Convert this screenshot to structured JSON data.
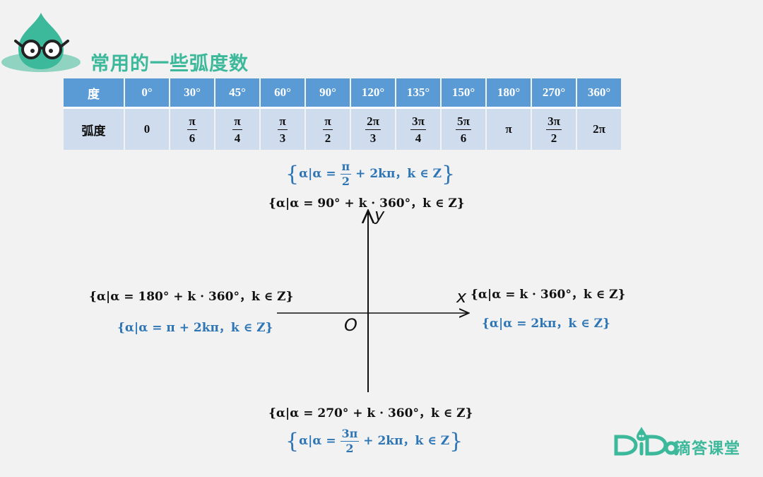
{
  "title": "常用的一些弧度数",
  "table": {
    "row1_label": "度",
    "row2_label": "弧度",
    "degrees": [
      "0°",
      "30°",
      "45°",
      "60°",
      "90°",
      "120°",
      "135°",
      "150°",
      "180°",
      "270°",
      "360°"
    ],
    "radians": [
      {
        "text": "0"
      },
      {
        "num": "π",
        "den": "6"
      },
      {
        "num": "π",
        "den": "4"
      },
      {
        "num": "π",
        "den": "3"
      },
      {
        "num": "π",
        "den": "2"
      },
      {
        "num": "2π",
        "den": "3"
      },
      {
        "num": "3π",
        "den": "4"
      },
      {
        "num": "5π",
        "den": "6"
      },
      {
        "text": "π"
      },
      {
        "num": "3π",
        "den": "2"
      },
      {
        "text": "2π"
      }
    ]
  },
  "axes": {
    "x_label": "x",
    "y_label": "y",
    "origin_label": "O"
  },
  "formulas": {
    "top_rad_pre": "α|α =",
    "top_rad_num": "π",
    "top_rad_den": "2",
    "top_rad_post": "+ 2kπ，k ∈ Z",
    "top_deg": "{α|α = 90° + k · 360°，k ∈ Z}",
    "left_deg": "{α|α = 180° + k · 360°，k ∈ Z}",
    "left_rad": "{α|α = π + 2kπ，k ∈ Z}",
    "right_deg": "{α|α = k · 360°，k ∈ Z}",
    "right_rad": "{α|α = 2kπ，k ∈ Z}",
    "bottom_deg": "{α|α = 270° + k · 360°，k ∈ Z}",
    "bottom_rad_pre": "α|α =",
    "bottom_rad_num": "3π",
    "bottom_rad_den": "2",
    "bottom_rad_post": "+ 2kπ，k ∈ Z"
  },
  "brand": {
    "logo_text": "滴答课堂",
    "logo_mark": "DiDa"
  },
  "colors": {
    "accent": "#3cb89a",
    "header_blue": "#5b9bd5",
    "cell_blue": "#cfdcee",
    "formula_blue": "#2e75b6"
  }
}
